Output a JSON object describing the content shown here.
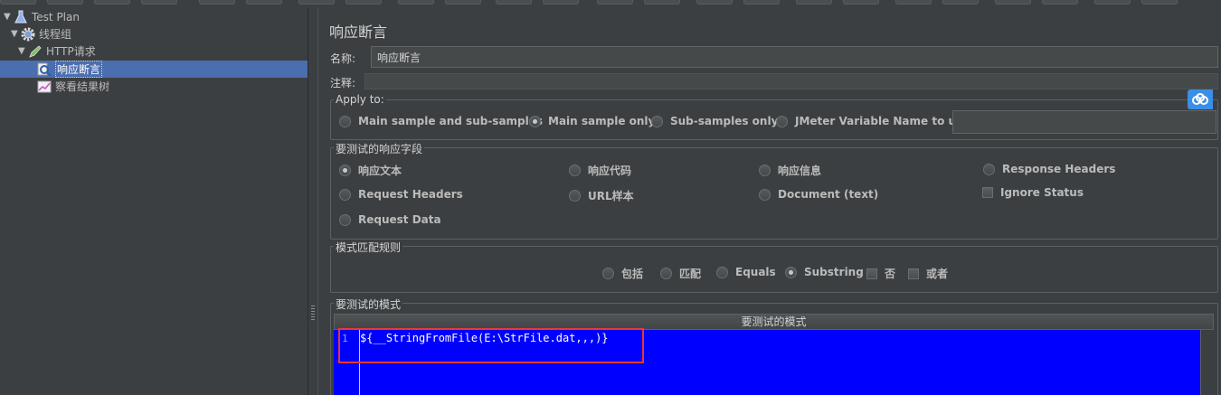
{
  "tree": {
    "items": [
      {
        "label": "Test Plan",
        "icon": "test-plan-flask-icon"
      },
      {
        "label": "线程组",
        "icon": "gear-icon"
      },
      {
        "label": "HTTP请求",
        "icon": "http-sampler-pen-icon"
      },
      {
        "label": "响应断言",
        "icon": "magnifier-assertion-icon"
      },
      {
        "label": "察看结果树",
        "icon": "chart-listener-icon"
      }
    ]
  },
  "panel": {
    "title": "响应断言",
    "name_label": "名称:",
    "name_value": "响应断言",
    "comment_label": "注释:",
    "apply_to": {
      "title": "Apply to:",
      "options": [
        "Main sample and sub-samples",
        "Main sample only",
        "Sub-samples only",
        "JMeter Variable Name to use"
      ],
      "selected": "Main sample only"
    },
    "field_to_test": {
      "title": "要测试的响应字段",
      "options": [
        "响应文本",
        "响应代码",
        "响应信息",
        "Response Headers",
        "Request Headers",
        "URL样本",
        "Document (text)",
        "Request Data"
      ],
      "selected": "响应文本",
      "ignore_status": "Ignore Status"
    },
    "pattern_matching": {
      "title": "模式匹配规则",
      "options": [
        "包括",
        "匹配",
        "Equals",
        "Substring"
      ],
      "selected": "Substring",
      "not_label": "否",
      "or_label": "或者"
    },
    "patterns": {
      "title": "要测试的模式",
      "column_header": "要测试的模式",
      "line_number": "1",
      "code": "${__StringFromFile(E:\\StrFile.dat,,,)}"
    }
  },
  "colors": {
    "background": "#3c3f41",
    "selection": "#4b6eaf",
    "editor_bg": "#0000ff",
    "highlight": "#e53935",
    "cloud_button": "#3b8ee6"
  }
}
